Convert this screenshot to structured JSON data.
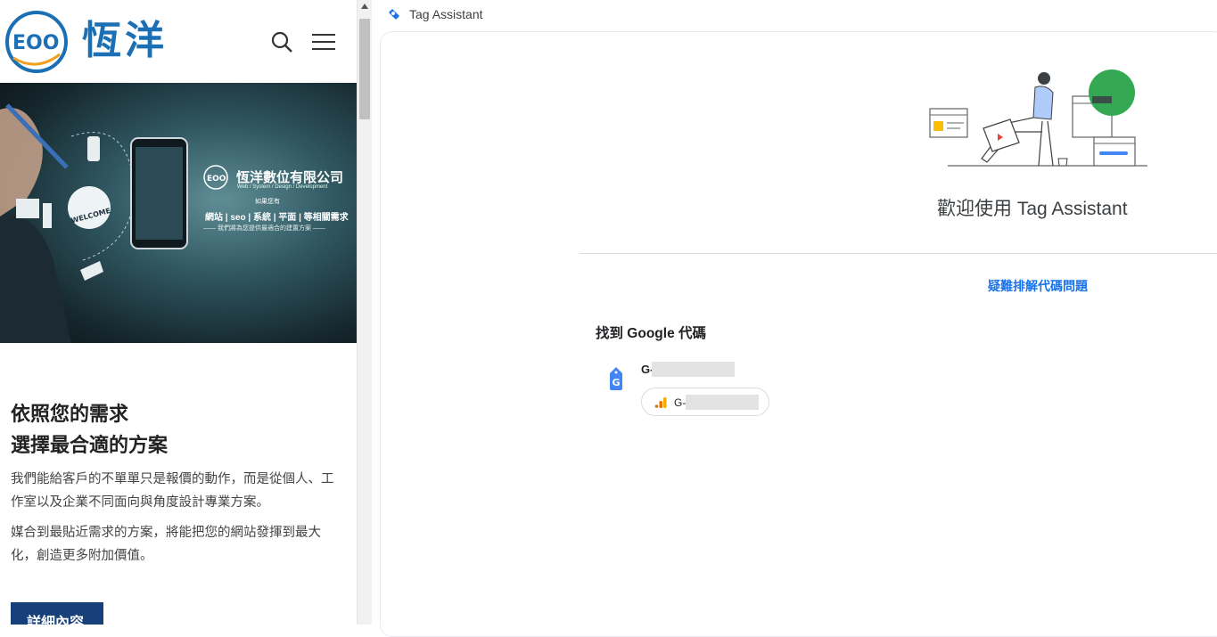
{
  "website": {
    "logo_text": "恆洋",
    "hero": {
      "company_name": "恆洋數位有限公司",
      "tagline_en": "Web / System / Design / Development",
      "line1": "如果您有",
      "services": "網站 | seo | 系統 | 平面 | 等相關需求",
      "line3": "—— 我們將為您提供最適合的建置方案 ——",
      "welcome_badge": "WELCOME"
    },
    "section_title_line1": "依照您的需求",
    "section_title_line2": "選擇最合適的方案",
    "para1": "我們能給客戶的不單單只是報價的動作，而是從個人、工作室以及企業不同面向與角度設計專業方案。",
    "para2": "媒合到最貼近需求的方案，將能把您的網站發揮到最大化，創造更多附加價值。",
    "detail_button": "詳細內容"
  },
  "tag_assistant": {
    "window_title": "Tag Assistant",
    "welcome": "歡迎使用 Tag Assistant",
    "troubleshoot_link": "疑難排解代碼問題",
    "found_title": "找到 Google 代碼",
    "tag_id_prefix": "G-",
    "destination_id_prefix": "G-",
    "colors": {
      "link_blue": "#1a73e8",
      "gtag_blue": "#4285f4",
      "ga_orange": "#f9ab00",
      "ga_dark_orange": "#e37400",
      "illustration_green": "#34a853",
      "illustration_yellow": "#fbbc04"
    }
  }
}
